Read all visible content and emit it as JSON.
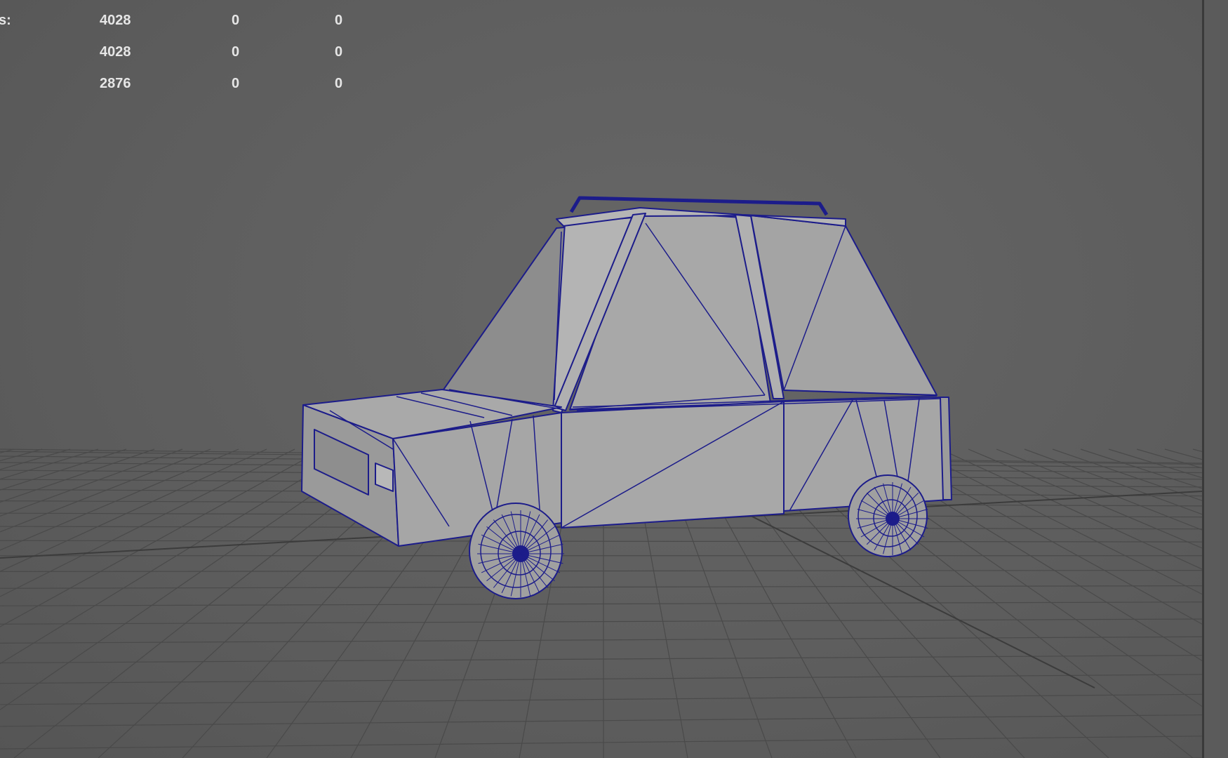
{
  "viewport": {
    "name": "3D perspective viewport",
    "grid": true,
    "model_display": "wireframe on shaded",
    "wire_color": "#1a1a8c",
    "shade_color": "#a6a6a6",
    "background_color": "#5f5f5f"
  },
  "hud": {
    "rows": [
      {
        "label": "s:",
        "values": [
          "4028",
          "0",
          "0"
        ]
      },
      {
        "label": "",
        "values": [
          "4028",
          "0",
          "0"
        ]
      },
      {
        "label": "",
        "values": [
          "2876",
          "0",
          "0"
        ]
      }
    ]
  }
}
